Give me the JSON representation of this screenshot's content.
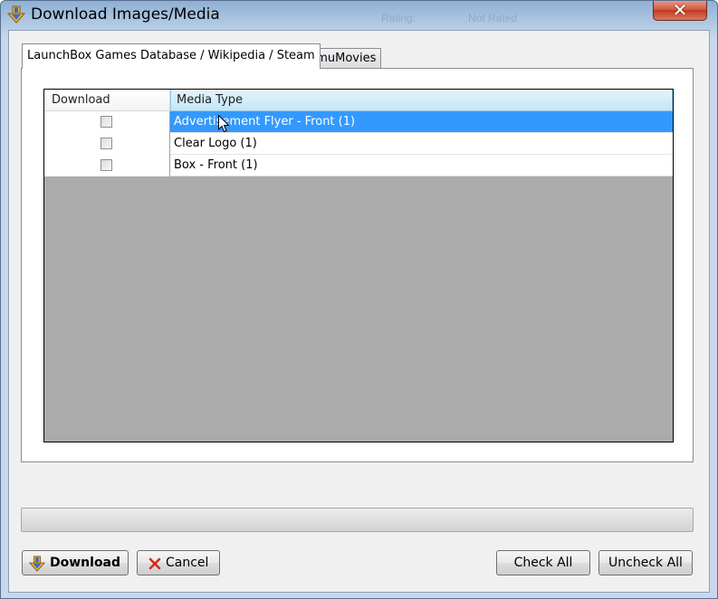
{
  "window": {
    "title": "Download Images/Media",
    "close_label": "✕",
    "background_ghost": [
      "Rating:",
      "Not Rated"
    ]
  },
  "tabs": [
    {
      "label": "LaunchBox Games Database / Wikipedia / Steam",
      "active": true
    },
    {
      "label": "EmuMovies",
      "active": false
    }
  ],
  "grid": {
    "columns": [
      "Download",
      "Media Type"
    ],
    "rows": [
      {
        "checked": false,
        "media_type": "Advertisement Flyer - Front (1)",
        "selected": true
      },
      {
        "checked": false,
        "media_type": "Clear Logo (1)",
        "selected": false
      },
      {
        "checked": false,
        "media_type": "Box - Front (1)",
        "selected": false
      }
    ]
  },
  "progress": {
    "value": 0
  },
  "buttons": {
    "download": "Download",
    "cancel": "Cancel",
    "check_all": "Check All",
    "uncheck_all": "Uncheck All"
  },
  "icons": {
    "title": "download-arrow-icon",
    "download": "download-arrow-icon",
    "cancel": "red-x-icon"
  },
  "colors": {
    "selection": "#3399ff",
    "grid_empty": "#ababab",
    "close_button": "#c94a31"
  }
}
